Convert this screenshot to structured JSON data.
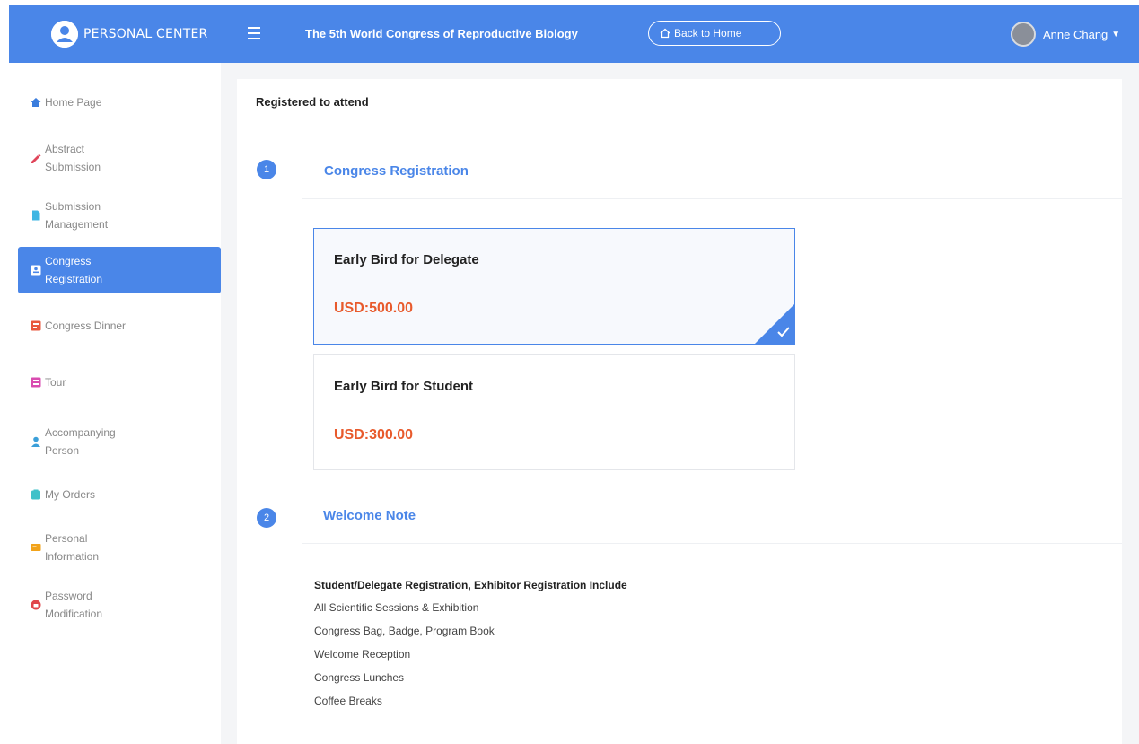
{
  "header": {
    "brand": "Personal Center",
    "event_title": "The 5th World Congress of Reproductive Biology",
    "back_home": "Back to Home",
    "user_name": "Anne Chang"
  },
  "sidebar": {
    "items": [
      {
        "label": "Home Page",
        "icon": "home-icon",
        "icon_color": "#3b7ddd"
      },
      {
        "label": "Abstract Submission",
        "icon": "pen-icon",
        "icon_color": "#e0455a"
      },
      {
        "label": "Submission Management",
        "icon": "document-icon",
        "icon_color": "#3fb6e3"
      },
      {
        "label": "Congress Registration",
        "icon": "id-card-icon",
        "icon_color": "#ffffff",
        "active": true
      },
      {
        "label": "Congress Dinner",
        "icon": "dinner-icon",
        "icon_color": "#e8573c"
      },
      {
        "label": "Tour",
        "icon": "tour-icon",
        "icon_color": "#d94bb0"
      },
      {
        "label": "Accompanying Person",
        "icon": "person-icon",
        "icon_color": "#3b9fd9"
      },
      {
        "label": "My Orders",
        "icon": "orders-icon",
        "icon_color": "#3fc1c9"
      },
      {
        "label": "Personal Information",
        "icon": "info-card-icon",
        "icon_color": "#f2a31a"
      },
      {
        "label": "Password Modification",
        "icon": "lock-icon",
        "icon_color": "#e0454a"
      }
    ]
  },
  "main": {
    "heading": "Registered to attend",
    "steps": [
      {
        "number": "1",
        "title": "Congress Registration"
      },
      {
        "number": "2",
        "title": "Welcome Note"
      }
    ],
    "options": [
      {
        "name": "Early Bird for Delegate",
        "price": "USD:500.00",
        "selected": true
      },
      {
        "name": "Early Bird for Student",
        "price": "USD:300.00",
        "selected": false
      }
    ],
    "note": {
      "heading": "Student/Delegate Registration, Exhibitor Registration Include",
      "items": [
        "All Scientific Sessions & Exhibition",
        "Congress Bag, Badge, Program Book",
        "Welcome Reception",
        "Congress Lunches",
        "Coffee Breaks"
      ]
    }
  },
  "colors": {
    "primary": "#4a86e8",
    "price": "#e85a2c"
  }
}
